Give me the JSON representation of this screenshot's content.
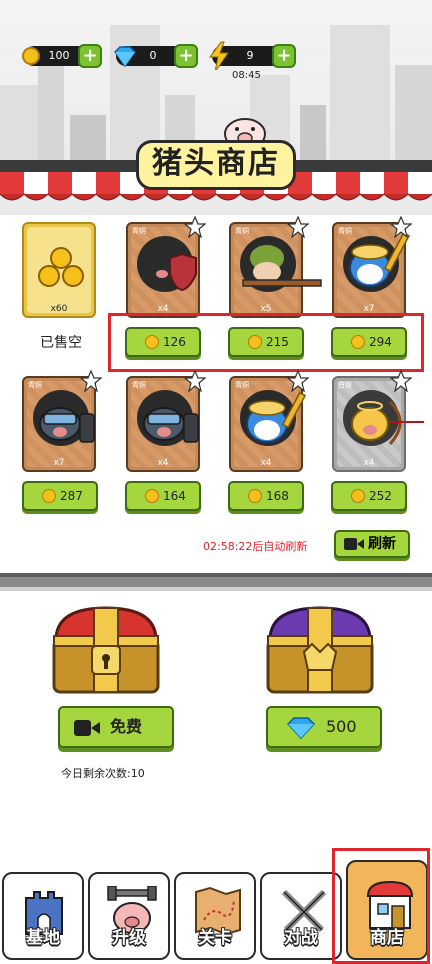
{
  "header": {
    "coins": "100",
    "gems": "0",
    "energy": "9",
    "energy_timer": "08:45"
  },
  "shop": {
    "title": "猪头商店",
    "sold_out_label": "已售空",
    "refresh_countdown": "02:58:22后自动刷新",
    "refresh_button": "刷新"
  },
  "items": [
    {
      "tier": "",
      "qty": "x60",
      "price": "",
      "frame": "gold"
    },
    {
      "tier": "青铜",
      "qty": "x4",
      "price": "126",
      "frame": "bronze"
    },
    {
      "tier": "青铜",
      "qty": "x5",
      "price": "215",
      "frame": "bronze"
    },
    {
      "tier": "青铜",
      "qty": "x7",
      "price": "294",
      "frame": "bronze"
    },
    {
      "tier": "青铜",
      "qty": "x7",
      "price": "287",
      "frame": "bronze"
    },
    {
      "tier": "青铜",
      "qty": "x4",
      "price": "164",
      "frame": "bronze"
    },
    {
      "tier": "青铜",
      "qty": "x4",
      "price": "168",
      "frame": "bronze"
    },
    {
      "tier": "白银",
      "qty": "x4",
      "price": "252",
      "frame": "silver"
    }
  ],
  "chests": {
    "free_label": "免费",
    "gem_price": "500",
    "remaining_today": "今日剩余次数:10"
  },
  "nav": [
    {
      "label": "基地"
    },
    {
      "label": "升级"
    },
    {
      "label": "关卡"
    },
    {
      "label": "对战"
    },
    {
      "label": "商店"
    }
  ],
  "colors": {
    "button_green": "#a6d63e",
    "highlight_red": "#e0262d",
    "active_tab": "#f3b55a"
  }
}
